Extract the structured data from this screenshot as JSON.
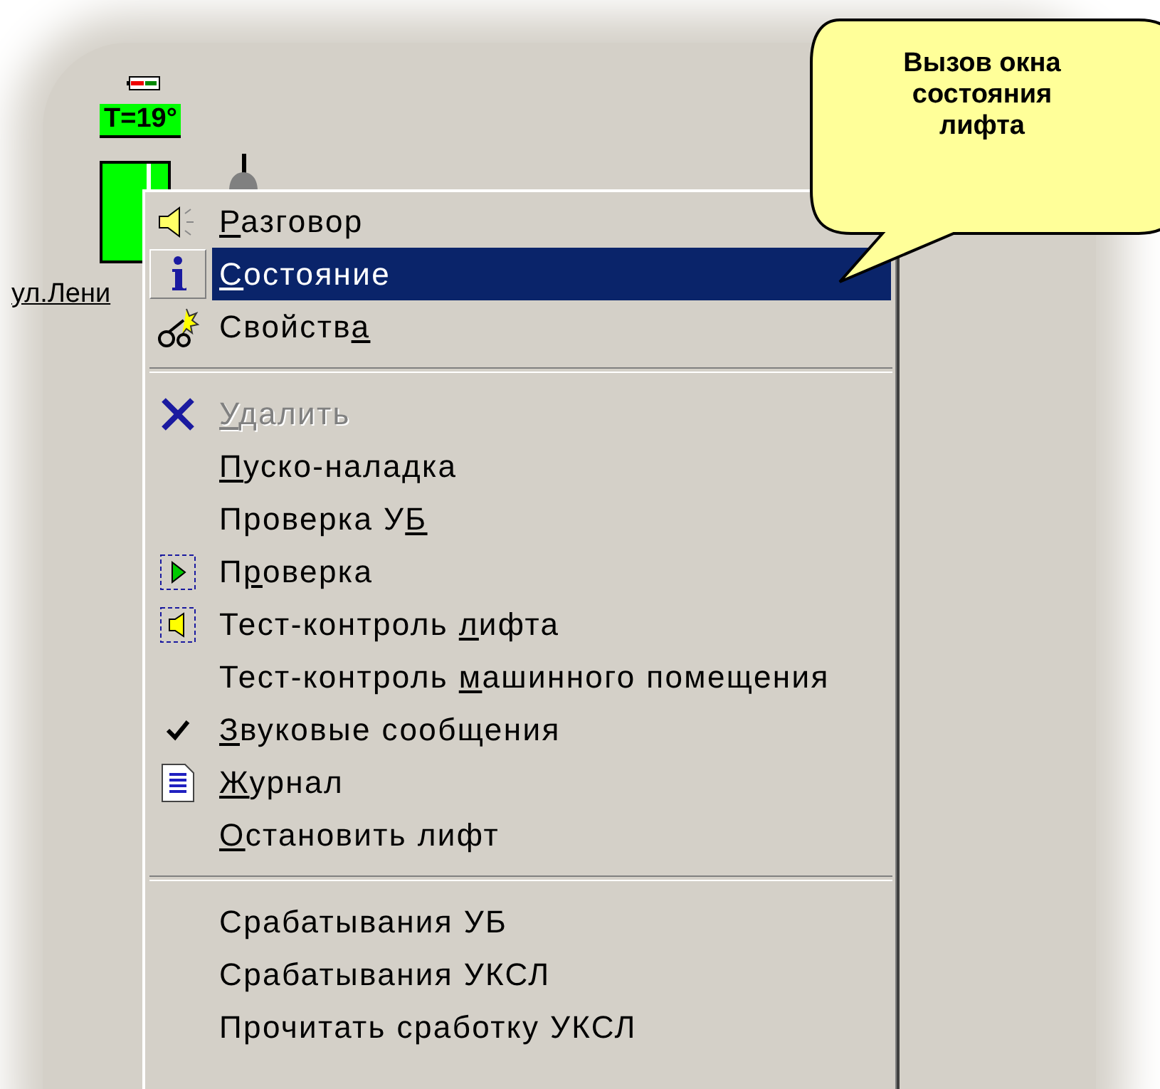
{
  "lift": {
    "temperature": "T=19°",
    "address": "ул.Лени"
  },
  "context_menu": {
    "groups": [
      [
        {
          "kind": "speaker",
          "key": "Р",
          "post": "азговор",
          "selected": false,
          "disabled": false,
          "checked": false
        },
        {
          "kind": "info",
          "key": "С",
          "post": "остояние",
          "selected": true,
          "disabled": false,
          "checked": false
        },
        {
          "kind": "props",
          "pre": "Свойств",
          "key": "а",
          "selected": false,
          "disabled": false,
          "checked": false
        }
      ],
      [
        {
          "kind": "delete",
          "key": "У",
          "post": "далить",
          "selected": false,
          "disabled": true,
          "checked": false
        },
        {
          "kind": "none",
          "key": "П",
          "post": "уско-наладка",
          "selected": false,
          "disabled": false,
          "checked": false
        },
        {
          "kind": "none",
          "pre": "Проверка У",
          "key": "Б",
          "selected": false,
          "disabled": false,
          "checked": false
        },
        {
          "kind": "play",
          "pre": "П",
          "key": "р",
          "post": "оверка",
          "selected": false,
          "disabled": false,
          "checked": false
        },
        {
          "kind": "test",
          "pre": "Тест-контроль ",
          "key": "л",
          "post": "ифта",
          "selected": false,
          "disabled": false,
          "checked": false
        },
        {
          "kind": "none",
          "pre": "Тест-контроль ",
          "key": "м",
          "post": "ашинного помещения",
          "selected": false,
          "disabled": false,
          "checked": false
        },
        {
          "kind": "none",
          "key": "З",
          "post": "вуковые сообщения",
          "selected": false,
          "disabled": false,
          "checked": true
        },
        {
          "kind": "log",
          "key": "Ж",
          "post": "урнал",
          "selected": false,
          "disabled": false,
          "checked": false
        },
        {
          "kind": "none",
          "key": "О",
          "post": "становить лифт",
          "selected": false,
          "disabled": false,
          "checked": false
        }
      ],
      [
        {
          "kind": "none",
          "pre": "Срабатывания УБ",
          "selected": false,
          "disabled": false,
          "checked": false
        },
        {
          "kind": "none",
          "pre": "Срабатывания УКСЛ",
          "selected": false,
          "disabled": false,
          "checked": false
        },
        {
          "kind": "none",
          "pre": "Прочитать сработку УКСЛ",
          "selected": false,
          "disabled": false,
          "checked": false
        }
      ]
    ]
  },
  "callout": {
    "text": "Вызов окна состояния лифта"
  }
}
